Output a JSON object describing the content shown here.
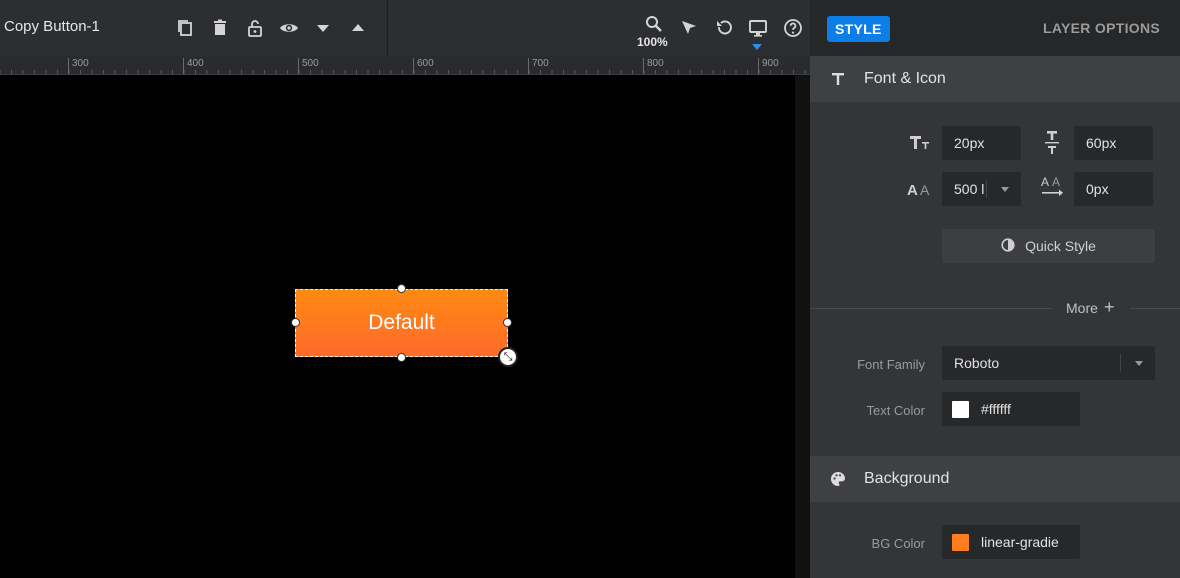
{
  "toolbar": {
    "layer_title": "Copy Button-1",
    "zoom": "100%",
    "icons": [
      "copy-icon",
      "trash-icon",
      "lock-icon",
      "eye-icon",
      "move-down-icon",
      "move-up-icon",
      "zoom-icon",
      "pointer-icon",
      "undo-icon",
      "desktop-icon",
      "help-icon"
    ]
  },
  "ruler": {
    "labels": [
      "300",
      "400",
      "500",
      "600",
      "700",
      "800",
      "900"
    ]
  },
  "canvas": {
    "layer_text": "Default"
  },
  "panel": {
    "tabs": {
      "style": "STYLE",
      "layer_options": "LAYER OPTIONS"
    },
    "font_section": {
      "title": "Font & Icon",
      "font_size": "20px",
      "line_height": "60px",
      "font_weight": "500 l",
      "letter_spacing": "0px",
      "quick_style": "Quick Style",
      "more": "More",
      "font_family_label": "Font Family",
      "font_family": "Roboto",
      "text_color_label": "Text Color",
      "text_color": "#ffffff"
    },
    "background_section": {
      "title": "Background",
      "bg_color_label": "BG Color",
      "bg_color": "linear-gradie",
      "bg_swatch": "#ff7d1f"
    }
  },
  "colors": {
    "accent": "#0d7ee8",
    "layer_gradient_top": "#ff8a12",
    "layer_gradient_bottom": "#ff6a2c"
  }
}
